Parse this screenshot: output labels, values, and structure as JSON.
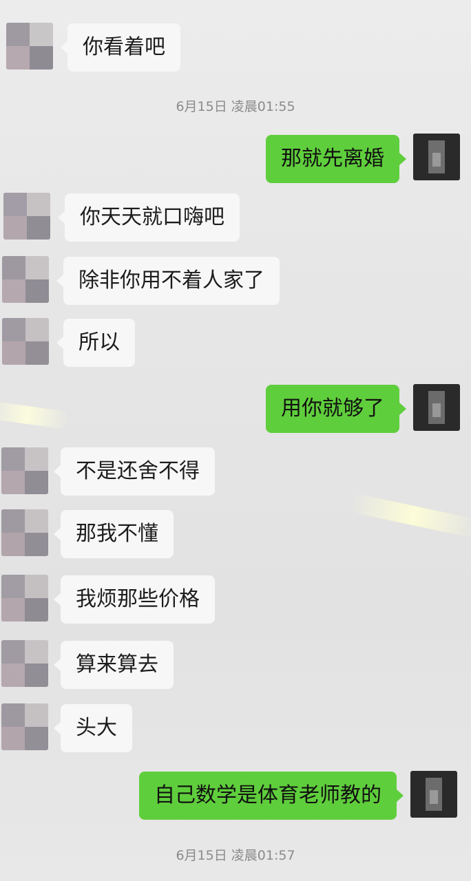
{
  "chat": {
    "messages": [
      {
        "side": "in",
        "text": "你看着吧"
      },
      {
        "type": "time",
        "text": "6月15日 凌晨01:55"
      },
      {
        "side": "out",
        "text": "那就先离婚"
      },
      {
        "side": "in",
        "text": "你天天就口嗨吧"
      },
      {
        "side": "in",
        "text": "除非你用不着人家了"
      },
      {
        "side": "in",
        "text": "所以"
      },
      {
        "side": "out",
        "text": "用你就够了"
      },
      {
        "side": "in",
        "text": "不是还舍不得"
      },
      {
        "side": "in",
        "text": "那我不懂"
      },
      {
        "side": "in",
        "text": "我烦那些价格"
      },
      {
        "side": "in",
        "text": "算来算去"
      },
      {
        "side": "in",
        "text": "头大"
      },
      {
        "side": "out",
        "text": "自己数学是体育老师教的"
      },
      {
        "type": "time",
        "text": "6月15日 凌晨01:57"
      }
    ]
  },
  "colors": {
    "outgoing_bubble": "#5fce3c",
    "incoming_bubble": "#f7f7f7",
    "timestamp_text": "#8a8a8a"
  },
  "icons": {
    "contact_avatar": "pixelated-avatar-icon",
    "self_avatar": "pixelated-avatar-icon"
  }
}
